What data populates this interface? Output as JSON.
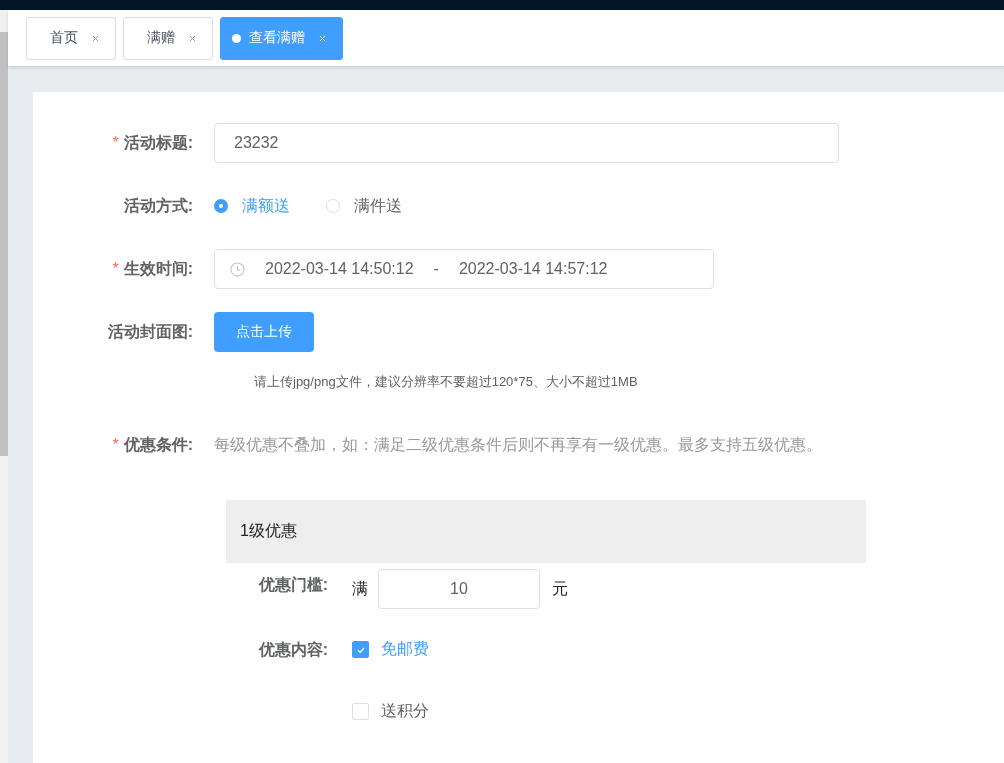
{
  "tabs": [
    {
      "label": "首页",
      "selected": false
    },
    {
      "label": "满赠",
      "selected": false
    },
    {
      "label": "查看满赠",
      "selected": true
    }
  ],
  "form": {
    "title_field": {
      "mark": "*",
      "label": "活动标题:",
      "value": "23232"
    },
    "mode": {
      "label": "活动方式:",
      "options": [
        {
          "label": "满额送",
          "selected": true
        },
        {
          "label": "满件送",
          "selected": false
        }
      ]
    },
    "time": {
      "mark": "*",
      "label": "生效时间:",
      "start": "2022-03-14 14:50:12",
      "separator": "-",
      "end": "2022-03-14 14:57:12"
    },
    "cover": {
      "label": "活动封面图:",
      "button": "点击上传",
      "hint": "请上传jpg/png文件，建议分辨率不要超过120*75、大小不超过1MB"
    },
    "condition": {
      "mark": "*",
      "label": "优惠条件:",
      "note": "每级优惠不叠加，如：满足二级优惠条件后则不再享有一级优惠。最多支持五级优惠。"
    },
    "tiers": [
      {
        "title": "1级优惠",
        "threshold_label": "优惠门槛:",
        "prefix": "满",
        "value": "10",
        "suffix": "元",
        "content_label": "优惠内容:",
        "options": [
          {
            "label": "免邮费",
            "checked": true
          },
          {
            "label": "送积分",
            "checked": false
          }
        ]
      }
    ]
  }
}
